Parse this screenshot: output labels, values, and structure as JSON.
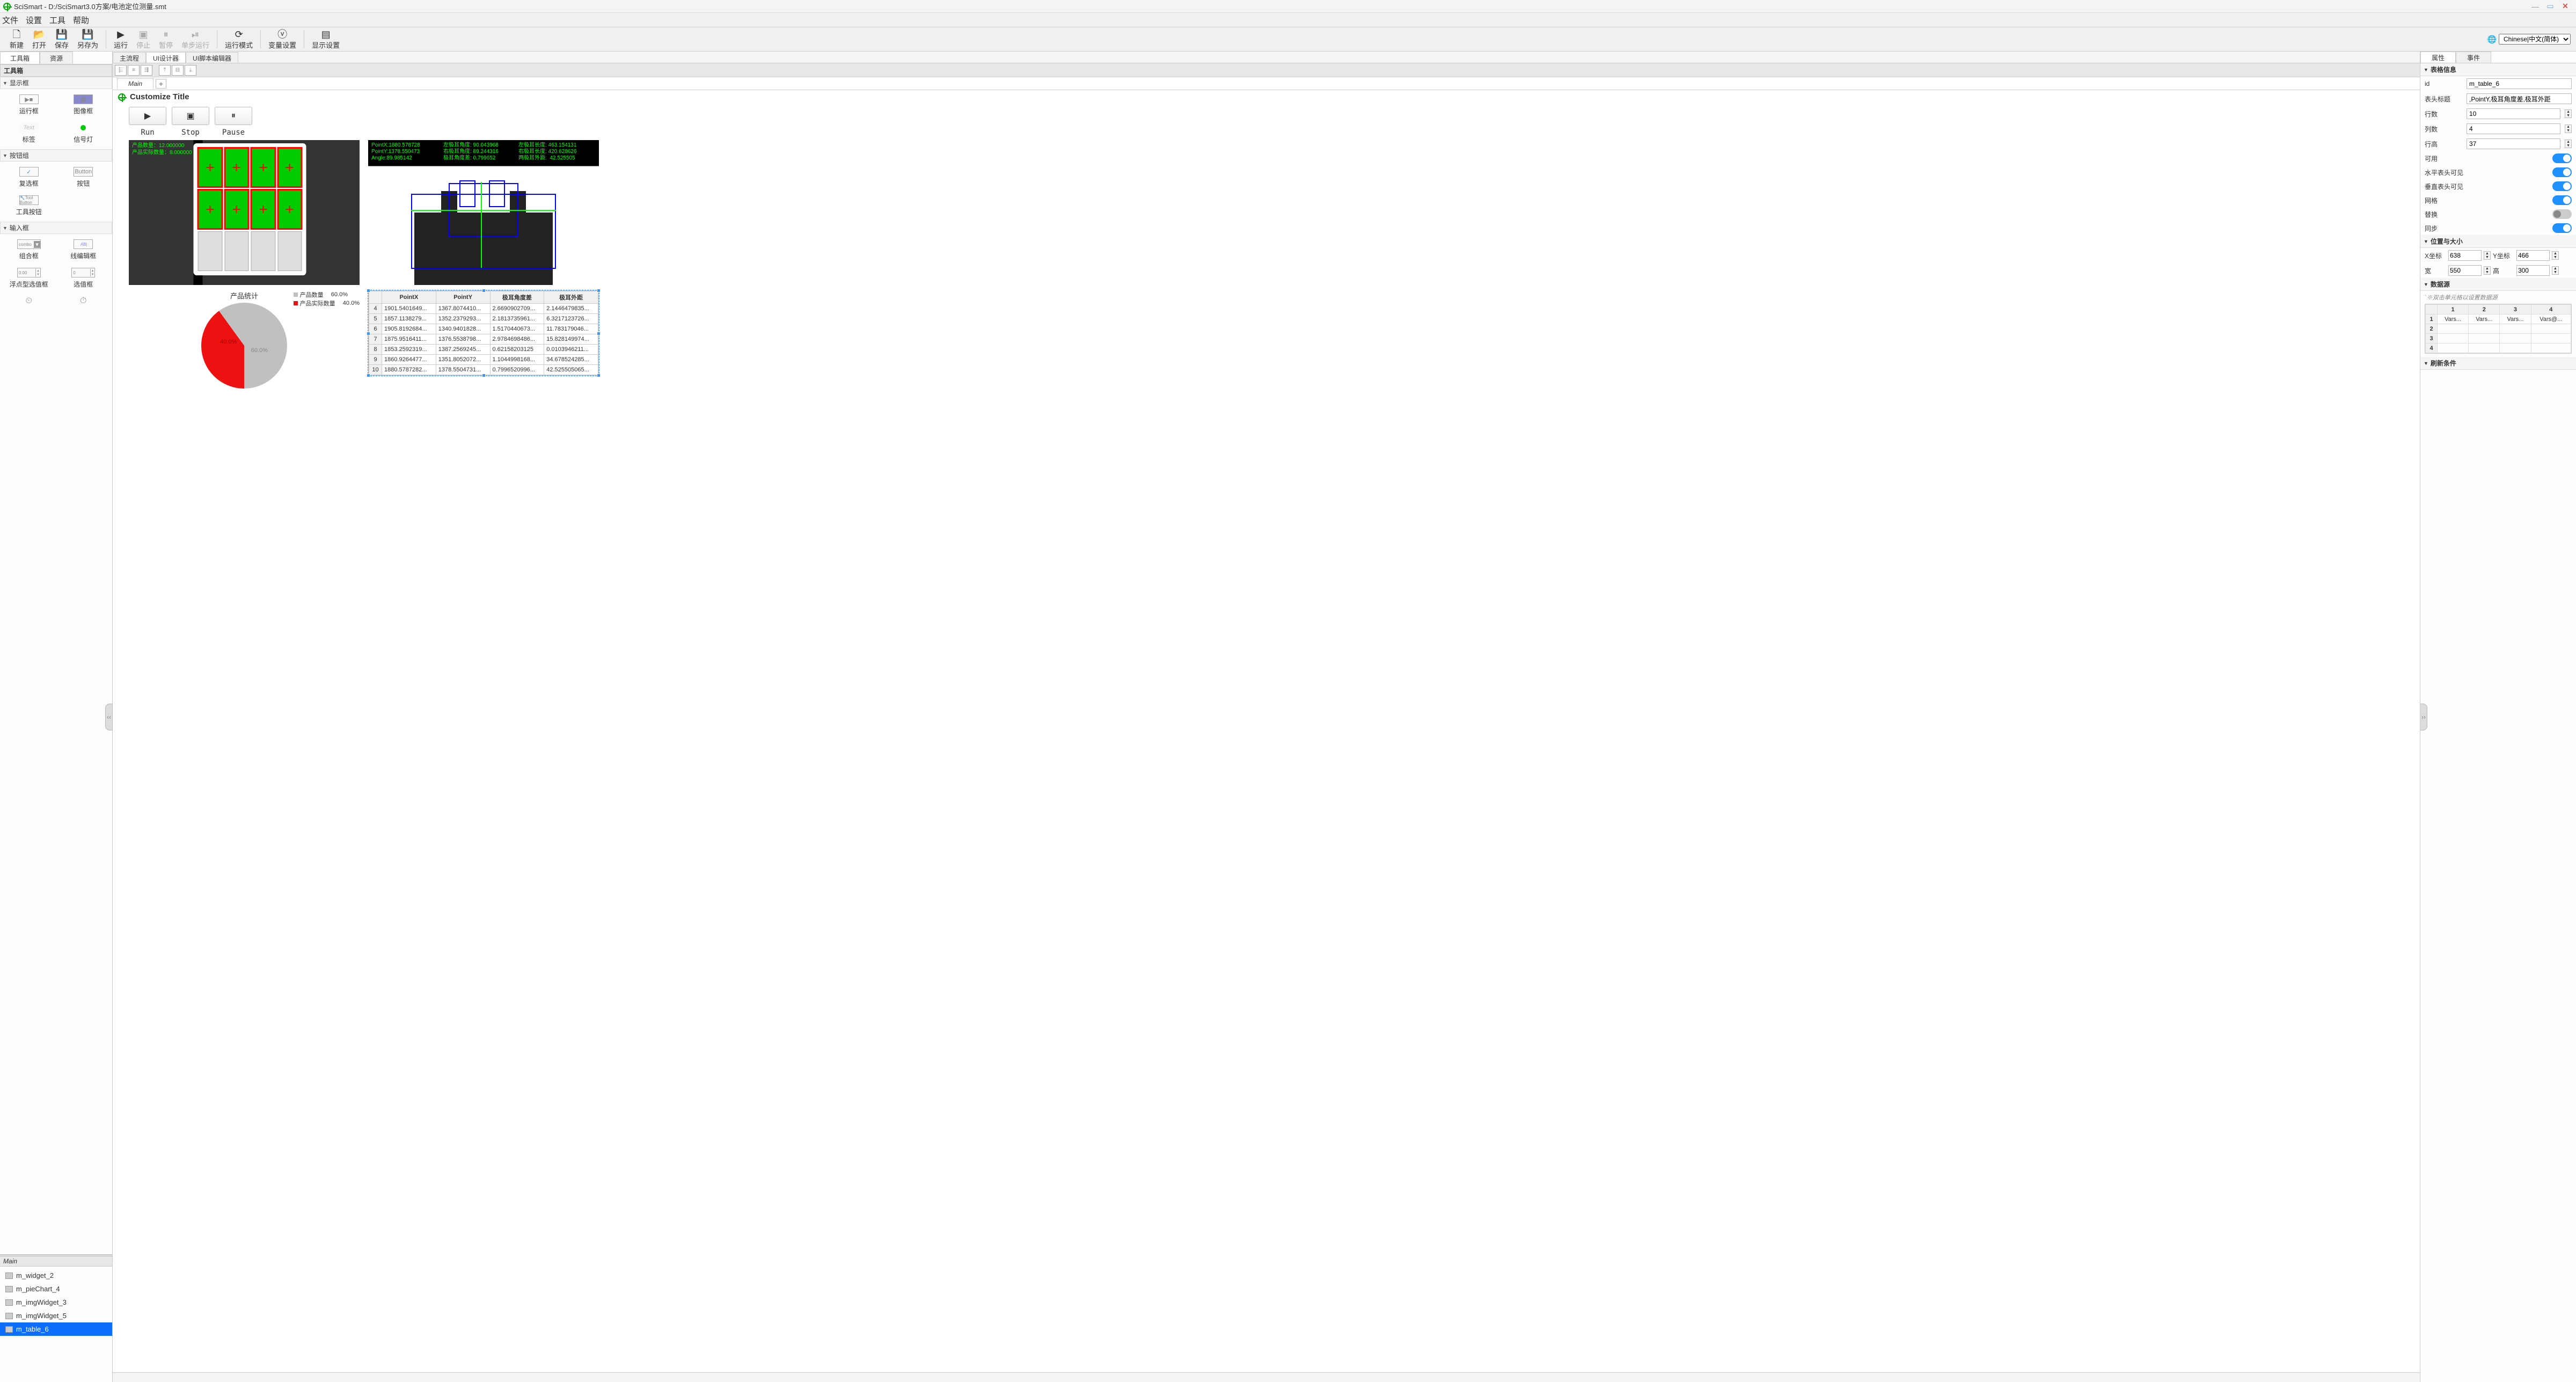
{
  "title": "SciSmart - D:/SciSmart3.0方案/电池定位测量.smt",
  "menu": [
    "文件",
    "设置",
    "工具",
    "帮助"
  ],
  "toolbar": {
    "new": "新建",
    "open": "打开",
    "save": "保存",
    "saveas": "另存为",
    "run": "运行",
    "stop": "停止",
    "pause": "暂停",
    "step": "单步运行",
    "mode": "运行模式",
    "vars": "变量设置",
    "disp": "显示设置"
  },
  "language": "Chinese|中文(简体)",
  "left_tabs": {
    "toolbox": "工具箱",
    "resource": "资源"
  },
  "toolbox_title": "工具箱",
  "group_display": {
    "title": "显示框",
    "items": [
      "运行框",
      "图像框",
      "标签",
      "信号灯"
    ]
  },
  "group_button": {
    "title": "按钮组",
    "items": [
      "复选框",
      "按钮",
      "工具按钮"
    ]
  },
  "group_input": {
    "title": "输入框",
    "items": [
      "组合框",
      "线编辑框",
      "浮点型选值框",
      "选值框"
    ]
  },
  "hierarchy_title": "Main",
  "tree": [
    "m_widget_2",
    "m_pieChart_4",
    "m_imgWidget_3",
    "m_imgWidget_5",
    "m_table_6"
  ],
  "tree_selected": "m_table_6",
  "center_tabs": [
    "主流程",
    "UI设计器",
    "UI脚本编辑器"
  ],
  "page_tab": "Main",
  "customize_title": "Customize Title",
  "rsp": {
    "run": "Run",
    "stop": "Stop",
    "pause": "Pause"
  },
  "image1_overlay": "产品数量：12.000000\n产品实际数量：8.000000",
  "img2": {
    "col1": "PointX:1880.578728\nPointY:1378.550473\nAngle:89.985142",
    "col2": "左极耳角度: 90.043968\n右极耳角度: 89.244316\n极耳角度差: 0.799652",
    "col3": "左极耳长度: 463.154131\n右极耳长度: 420.628626\n两极耳外距:  42.525505"
  },
  "chart_data": {
    "type": "pie",
    "title": "产品统计",
    "series": [
      {
        "name": "产品数量",
        "value": 60.0,
        "color": "#c0c0c0"
      },
      {
        "name": "产品实际数量",
        "value": 40.0,
        "color": "#e11"
      }
    ],
    "labels": {
      "main": "60.0%",
      "red": "40.0%"
    },
    "legend_values": [
      "60.0%",
      "40.0%"
    ]
  },
  "table": {
    "headers": [
      "PointX",
      "PointY",
      "极耳角度差",
      "极耳外距"
    ],
    "start_row": 4,
    "rows": [
      [
        "1901.5401649...",
        "1367.8074410...",
        "2.6690902709...",
        "2.1446479835..."
      ],
      [
        "1857.1138279...",
        "1352.2379293...",
        "2.1813735961...",
        "6.3217123726..."
      ],
      [
        "1905.8192684...",
        "1340.9401828...",
        "1.5170440673...",
        "11.783179046..."
      ],
      [
        "1875.9516411...",
        "1376.5538798...",
        "2.9784698486...",
        "15.828149974..."
      ],
      [
        "1853.2592319...",
        "1387.2569245...",
        "0.62158203125",
        "0.0103946211..."
      ],
      [
        "1860.9264477...",
        "1351.8052072...",
        "1.1044998168...",
        "34.678524285..."
      ],
      [
        "1880.5787282...",
        "1378.5504731...",
        "0.7996520996...",
        "42.525505065..."
      ]
    ]
  },
  "right_tabs": {
    "prop": "属性",
    "event": "事件"
  },
  "prop_sections": {
    "tableinfo": "表格信息",
    "possize": "位置与大小",
    "datasrc": "数据源",
    "refresh": "刷新条件"
  },
  "props": {
    "id_lbl": "id",
    "id_val": "m_table_6",
    "header_lbl": "表头标题",
    "header_val": ",PointY,极耳角度差,极耳外距",
    "rows_lbl": "行数",
    "rows_val": "10",
    "cols_lbl": "列数",
    "cols_val": "4",
    "rowh_lbl": "行高",
    "rowh_val": "37",
    "enabled": "可用",
    "hhdr": "水平表头可见",
    "vhdr": "垂直表头可见",
    "grid": "网格",
    "alt": "替换",
    "sync": "同步"
  },
  "pos": {
    "x_lbl": "X坐标",
    "x": "638",
    "y_lbl": "Y坐标",
    "y": "466",
    "w_lbl": "宽",
    "w": "550",
    "h_lbl": "高",
    "h": "300"
  },
  "ds_hint": "`※双击单元格以设置数据源",
  "ds_cols": [
    "1",
    "2",
    "3",
    "4"
  ],
  "ds_row1": [
    "Vars...",
    "Vars...",
    "Vars...",
    "Vars@..."
  ]
}
